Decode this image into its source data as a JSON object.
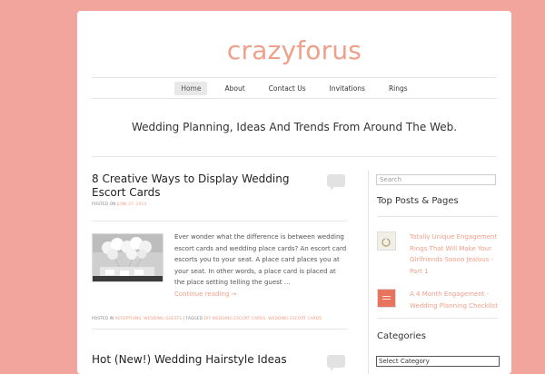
{
  "site": {
    "title": "crazyforus",
    "tagline": "Wedding Planning, Ideas And Trends From Around The Web."
  },
  "nav": [
    "Home",
    "About",
    "Contact Us",
    "Invitations",
    "Rings"
  ],
  "posts": [
    {
      "title": "8 Creative Ways to Display Wedding Escort Cards",
      "posted_on_label": "POSTED ON",
      "date": "JUNE 27, 2014",
      "excerpt": "Ever wonder what the difference is between wedding escort cards and wedding place cards? An escort card escorts you to your seat. A place card places you at your seat. In other words, a place card is placed at the place setting telling the guest …",
      "continue": "Continue reading →",
      "posted_in_label": "POSTED IN",
      "categories": "RECEPTIONS, WEDDING GUESTS",
      "separator": " | ",
      "tagged_label": "TAGGED",
      "tags": "DIY WEDDING ESCORT CARDS, WEDDING ESCORT CARDS"
    },
    {
      "title": "Hot (New!) Wedding Hairstyle Ideas"
    }
  ],
  "sidebar": {
    "search_placeholder": "Search",
    "top_posts_title": "Top Posts & Pages",
    "top_posts": [
      {
        "title": "Totally Unique Engagement Rings That Will Make Your Girlfriends Soooo Jealous - Part 1"
      },
      {
        "title": "A 4 Month Engagement - Wedding Planning Checklist"
      }
    ],
    "categories_title": "Categories",
    "select_label": "Select Category"
  },
  "colors": {
    "background": "#f2a59c",
    "accent": "#f0a08a"
  }
}
